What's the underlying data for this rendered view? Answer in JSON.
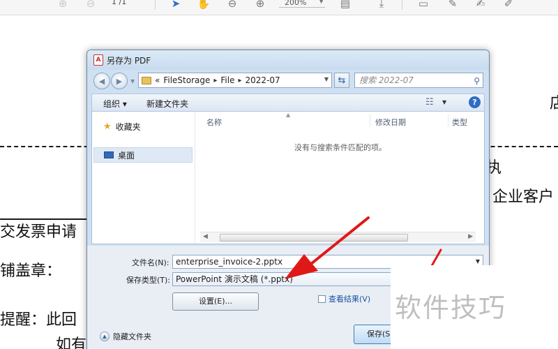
{
  "viewer": {
    "page_current": "1",
    "page_total": "/1",
    "zoom": "200%"
  },
  "document": {
    "right_top": "店",
    "right_mid": "执",
    "right_mid2": "企业客户",
    "left1": "交发票申请",
    "left2": "铺盖章：",
    "left3": "提醒：此回",
    "left4": "如有"
  },
  "dialog": {
    "title": "另存为 PDF",
    "title_icon_text": "A",
    "breadcrumb": {
      "lead": "«",
      "parts": [
        "FileStorage",
        "File",
        "2022-07"
      ],
      "separator": "▸"
    },
    "search_placeholder": "搜索 2022-07",
    "toolbar": {
      "organize": "组织 ▾",
      "new_folder": "新建文件夹"
    },
    "nav": {
      "favorites": "收藏夹",
      "desktop": "桌面"
    },
    "columns": {
      "name": "名称",
      "modified": "修改日期",
      "type": "类型"
    },
    "empty_message": "没有与搜索条件匹配的项。",
    "form": {
      "filename_label": "文件名(N):",
      "filename_value": "enterprise_invoice-2.pptx",
      "filetype_label": "保存类型(T):",
      "filetype_value": "PowerPoint 演示文稿 (*.pptx)",
      "settings_button": "设置(E)...",
      "view_result": "查看结果(V)",
      "hide_folders": "隐藏文件夹",
      "save_button": "保存(S"
    }
  },
  "watermark": "软件技巧",
  "colors": {
    "dialog_frame": "#cfe0f2",
    "annotation_arrow": "#e01818",
    "link_blue": "#1a52a3"
  }
}
